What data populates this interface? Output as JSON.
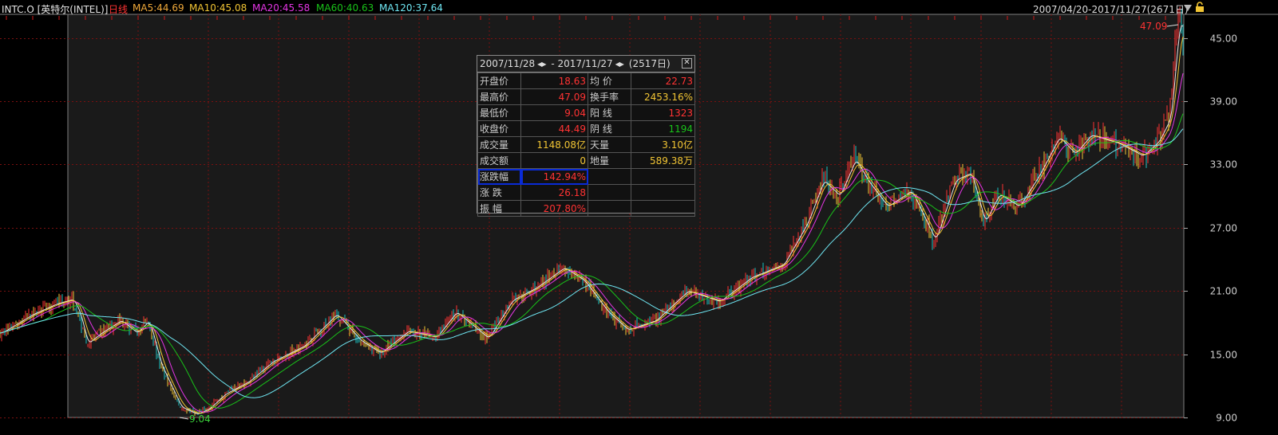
{
  "header": {
    "ticker": "INTC.O [英特尔(INTEL)]",
    "period": "日线",
    "ma5": "MA5:44.69",
    "ma10": "MA10:45.08",
    "ma20": "MA20:45.58",
    "ma60": "MA60:40.63",
    "ma120": "MA120:37.64",
    "date_range": "2007/04/20-2017/11/27(2671日)"
  },
  "colors": {
    "ma5": "#e8e8e8",
    "ma10": "#f2c534",
    "ma20": "#e535e5",
    "ma60": "#19c219",
    "ma120": "#6fe6f2",
    "up": "#ff3333",
    "down": "#19c2c2",
    "price_label": "#ff3333",
    "low_label": "#3ad23a",
    "axis_text": "#cccccc",
    "grid": "#7a1010"
  },
  "icons": {
    "dropdown": "triangle-down-icon",
    "lock": "lock-icon",
    "close": "close-icon",
    "arrows": "left-right-arrows-icon"
  },
  "chart_data": {
    "type": "candlestick",
    "y_axis": {
      "ticks": [
        "45.00",
        "39.00",
        "33.00",
        "27.00",
        "21.00",
        "15.00",
        "9.00"
      ],
      "ylim": [
        9,
        47.1
      ]
    },
    "max_label": "47.09",
    "min_label": "9.04",
    "x_range": [
      "2007/04/20",
      "2017/11/27"
    ],
    "trading_days": 2671,
    "anchors": [
      [
        0,
        17
      ],
      [
        40,
        18.8
      ],
      [
        70,
        19.8
      ],
      [
        90,
        20.2
      ],
      [
        98,
        19
      ],
      [
        108,
        16
      ],
      [
        125,
        17
      ],
      [
        150,
        18.2
      ],
      [
        170,
        17
      ],
      [
        185,
        18.2
      ],
      [
        200,
        14
      ],
      [
        225,
        10
      ],
      [
        245,
        9.3
      ],
      [
        260,
        9.8
      ],
      [
        280,
        11.2
      ],
      [
        310,
        12.4
      ],
      [
        340,
        14.3
      ],
      [
        380,
        15.8
      ],
      [
        420,
        18.8
      ],
      [
        450,
        16.3
      ],
      [
        475,
        15.1
      ],
      [
        510,
        17.2
      ],
      [
        545,
        16.6
      ],
      [
        570,
        19
      ],
      [
        610,
        16.5
      ],
      [
        640,
        20.1
      ],
      [
        670,
        21.3
      ],
      [
        705,
        23.2
      ],
      [
        730,
        22
      ],
      [
        760,
        19
      ],
      [
        785,
        17.3
      ],
      [
        820,
        18.2
      ],
      [
        860,
        21
      ],
      [
        900,
        20
      ],
      [
        940,
        22.3
      ],
      [
        980,
        23.5
      ],
      [
        1010,
        27.5
      ],
      [
        1030,
        31.5
      ],
      [
        1050,
        30
      ],
      [
        1070,
        33.5
      ],
      [
        1085,
        31.5
      ],
      [
        1110,
        29
      ],
      [
        1140,
        30.5
      ],
      [
        1170,
        25.8
      ],
      [
        1195,
        31.5
      ],
      [
        1215,
        32.2
      ],
      [
        1232,
        27.5
      ],
      [
        1250,
        30.2
      ],
      [
        1275,
        29
      ],
      [
        1300,
        32
      ],
      [
        1325,
        35.6
      ],
      [
        1345,
        34
      ],
      [
        1365,
        35.8
      ],
      [
        1400,
        35
      ],
      [
        1430,
        33.8
      ],
      [
        1450,
        35.2
      ],
      [
        1465,
        37.5
      ],
      [
        1473,
        44.6
      ],
      [
        1478,
        47.09
      ],
      [
        1483,
        44.5
      ]
    ],
    "series_ma": [
      "MA5",
      "MA10",
      "MA20",
      "MA60",
      "MA120"
    ]
  },
  "popup": {
    "start_date": "2007/11/28",
    "sep": "-",
    "end_date": "2017/11/27",
    "days": "(2517日)",
    "rows": [
      {
        "l1": "开盘价",
        "v1": "18.63",
        "c1": "#ff3333",
        "l2": "均  价",
        "v2": "22.73",
        "c2": "#ff3333"
      },
      {
        "l1": "最高价",
        "v1": "47.09",
        "c1": "#ff3333",
        "l2": "换手率",
        "v2": "2453.16%",
        "c2": "#f2c534"
      },
      {
        "l1": "最低价",
        "v1": "9.04",
        "c1": "#ff3333",
        "l2": "阳  线",
        "v2": "1323",
        "c2": "#ff3333"
      },
      {
        "l1": "收盘价",
        "v1": "44.49",
        "c1": "#ff3333",
        "l2": "阴  线",
        "v2": "1194",
        "c2": "#19c219"
      },
      {
        "l1": "成交量",
        "v1": "1148.08亿",
        "c1": "#f2c534",
        "l2": "天量",
        "v2": "3.10亿",
        "c2": "#f2c534"
      },
      {
        "l1": "成交额",
        "v1": "0",
        "c1": "#f2c534",
        "l2": "地量",
        "v2": "589.38万",
        "c2": "#f2c534"
      },
      {
        "l1": "涨跌幅",
        "v1": "142.94%",
        "c1": "#ff3333",
        "l2": "",
        "v2": "",
        "c2": "#ccc"
      },
      {
        "l1": "涨  跌",
        "v1": "26.18",
        "c1": "#ff3333",
        "l2": "",
        "v2": "",
        "c2": "#ccc"
      },
      {
        "l1": "振  幅",
        "v1": "207.80%",
        "c1": "#ff3333",
        "l2": "",
        "v2": "",
        "c2": "#ccc"
      }
    ]
  }
}
